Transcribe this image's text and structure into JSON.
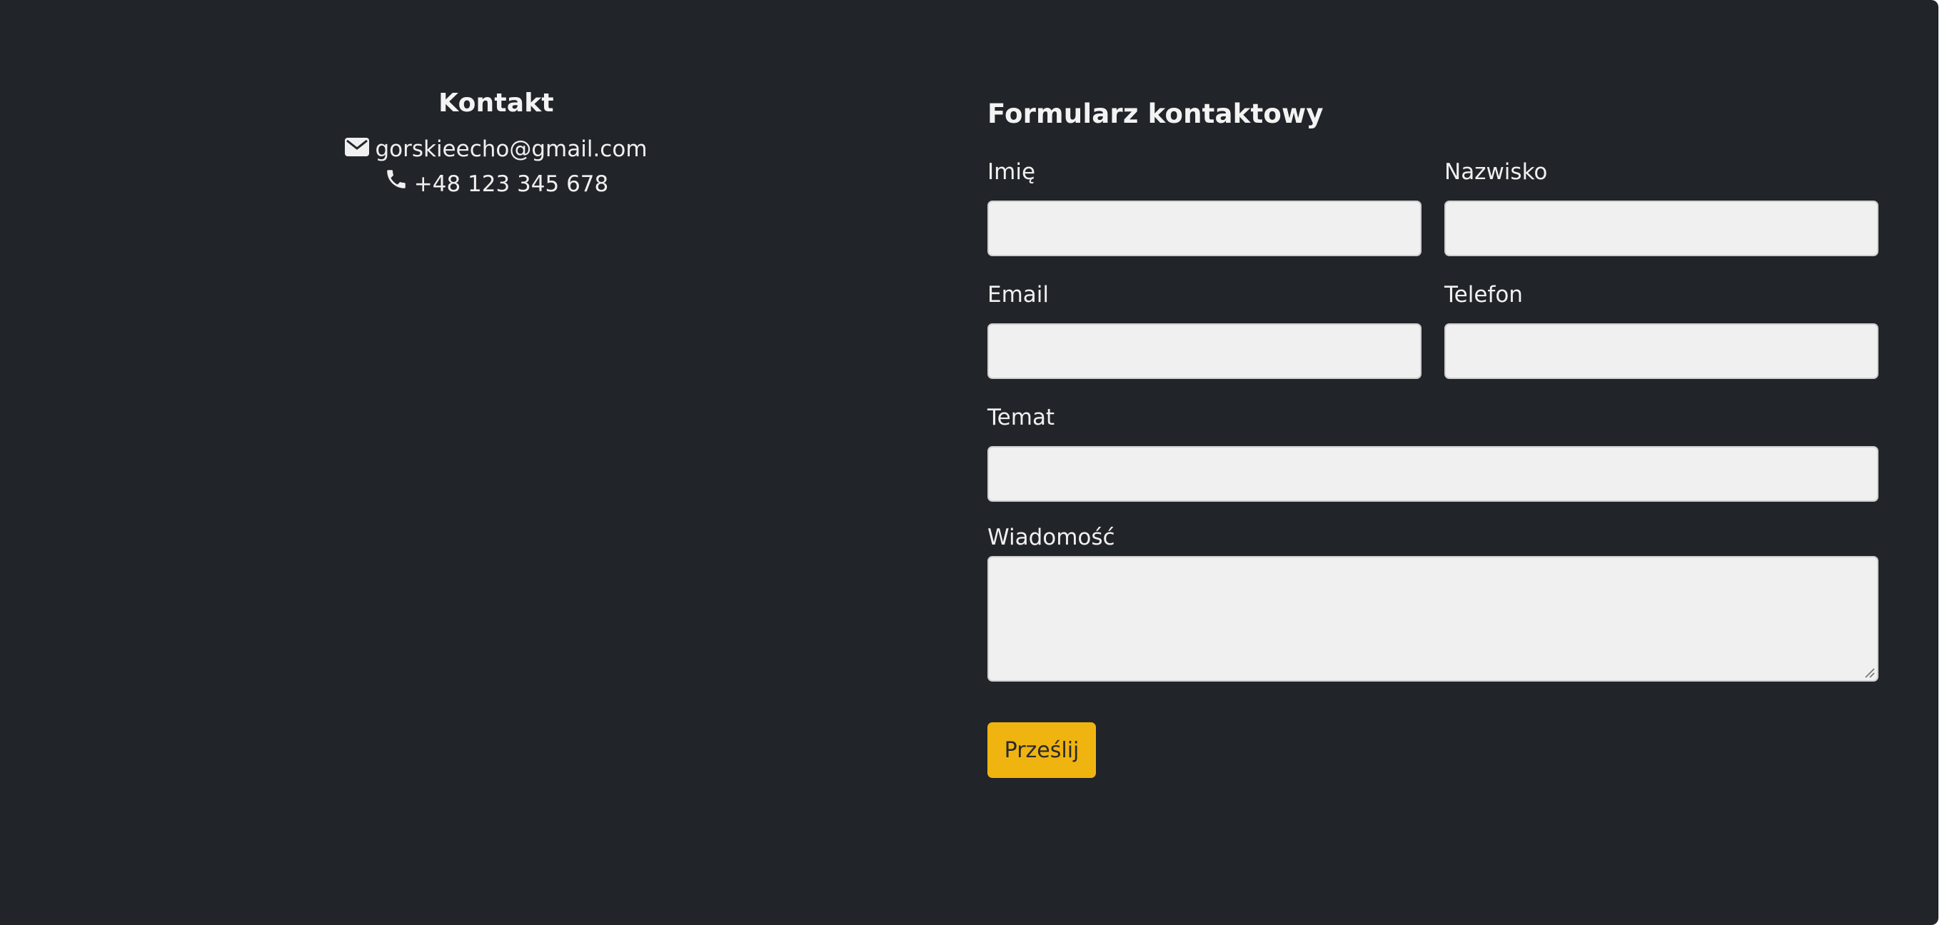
{
  "contact": {
    "heading": "Kontakt",
    "email": "gorskieecho@gmail.com",
    "phone": "+48 123 345 678",
    "email_icon": "envelope-icon",
    "phone_icon": "phone-icon"
  },
  "form": {
    "title": "Formularz kontaktowy",
    "first_name": {
      "label": "Imię",
      "value": "",
      "placeholder": ""
    },
    "last_name": {
      "label": "Nazwisko",
      "value": "",
      "placeholder": ""
    },
    "email": {
      "label": "Email",
      "value": "",
      "placeholder": ""
    },
    "phone": {
      "label": "Telefon",
      "value": "",
      "placeholder": ""
    },
    "subject": {
      "label": "Temat",
      "value": "",
      "placeholder": ""
    },
    "message": {
      "label": "Wiadomość",
      "value": "",
      "placeholder": ""
    },
    "submit_label": "Prześlij"
  },
  "colors": {
    "background": "#212429",
    "input_background": "#f0f0f0",
    "button_accent": "#f0b410"
  }
}
